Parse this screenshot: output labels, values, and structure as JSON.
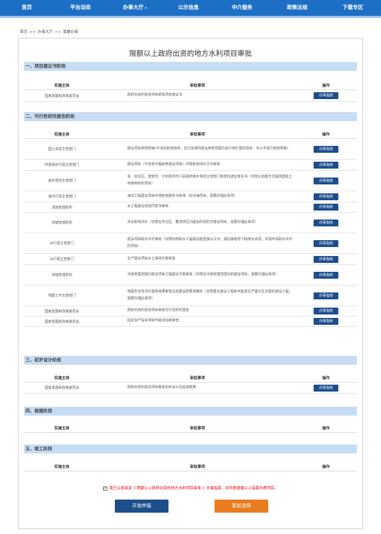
{
  "nav": {
    "items": [
      {
        "label": "首页"
      },
      {
        "label": "平台动态"
      },
      {
        "label": "办事大厅"
      },
      {
        "label": "公示信息"
      },
      {
        "label": "中介服务"
      },
      {
        "label": "政策法规"
      },
      {
        "label": "下载专区"
      }
    ],
    "dropdown_arrow": "▾"
  },
  "breadcrumb": [
    "首页",
    ">>",
    "办事大厅",
    ">>",
    "我要办事"
  ],
  "page_title": "限额以上政府出资的地方水利项目审批",
  "table_headers": {
    "agency": "实施主体",
    "item": "审批事项",
    "action": "操作"
  },
  "apply_label": "办事指南",
  "sections": [
    {
      "title": "一、项目建议书阶段",
      "rows": [
        {
          "agency": "国家发展和改革委员会",
          "item": "政府出资的投资项目审批项目建议书"
        }
      ]
    },
    {
      "title": "二、可行性研究报告阶段",
      "rows": [
        {
          "agency": "国土资源主管部门",
          "item": "建设项目用地预审(不涉及新增用地，在已批准的建设用地范围内进行改扩建的项目，可以不进行用地预审)"
        },
        {
          "agency": "环境保护行政主管部门",
          "item": "建设项目（不含核与辐射类建设项目）环境影响评价文件审批"
        },
        {
          "agency": "城乡规划主管部门",
          "item": "省、自治区、直辖市、计划单列市人民政府城乡规划主管部门核发的选址意见书（仅限以划拨方式提供国有土地使用权的项目）"
        },
        {
          "agency": "海洋行政主管部门",
          "item": "海洋工程建设项目环境影响报告书核准（仅涉海项目，需要办理此事项）"
        },
        {
          "agency": "流域管理机构",
          "item": "水工程建设规划同意书审核"
        },
        {
          "agency": "流域管理机构",
          "item": "洪水影响评价（仅限在洪泛区、蓄滞洪区内建设的非防洪建设项目，需要办理此事项）"
        },
        {
          "agency": "水行政主管部门",
          "item": "建设项目取水许可审批（仅限利用取水工程或设施直接从江河、湖泊或者地下取用水资源，并需申请取水许可的项目）"
        },
        {
          "agency": "水行政主管部门",
          "item": "生产建设项目水土保持方案审批"
        },
        {
          "agency": "流域管理机构",
          "item": "河道管理范围内建设项目工程建设方案审批（仅限在河道管理范围内的建设项目，需要办理此事项）"
        },
        {
          "agency": "地震工作主管部门",
          "item": "地震安全性评价报告结果审查及抗震设防要求确定（仅限重大建设工程和可能发生严重次生灾害的建设工程，需要办理此事项）"
        },
        {
          "agency": "国家发展和改革委员会",
          "item": "政府出资的投资项目审批可行性研究报告"
        },
        {
          "agency": "国家发展和改革委员会",
          "item": "固定资产投资项目节能评估和审查"
        }
      ]
    },
    {
      "title": "三、初步设计阶段",
      "rows": [
        {
          "agency": "国家发展和改革委员会",
          "item": "政府出资的投资项目审批初步设计及投资概算"
        }
      ]
    },
    {
      "title": "四、报建阶段",
      "rows": []
    },
    {
      "title": "五、竣工阶段",
      "rows": []
    }
  ],
  "agreement": {
    "checkmark": "✓",
    "text": "我已认真阅读《 限额以上政府出资的地方水利项目审批 》办事指南，并同意遵循以上指南办理项目。"
  },
  "buttons": {
    "start": "开始申报",
    "reset": "重新选择"
  },
  "colors": {
    "nav": "#1d6fc5",
    "section": "#c6ddf4",
    "primary_button": "#1d4e8c",
    "reset_button": "#e87c1e",
    "agreement_text": "#e60000"
  }
}
